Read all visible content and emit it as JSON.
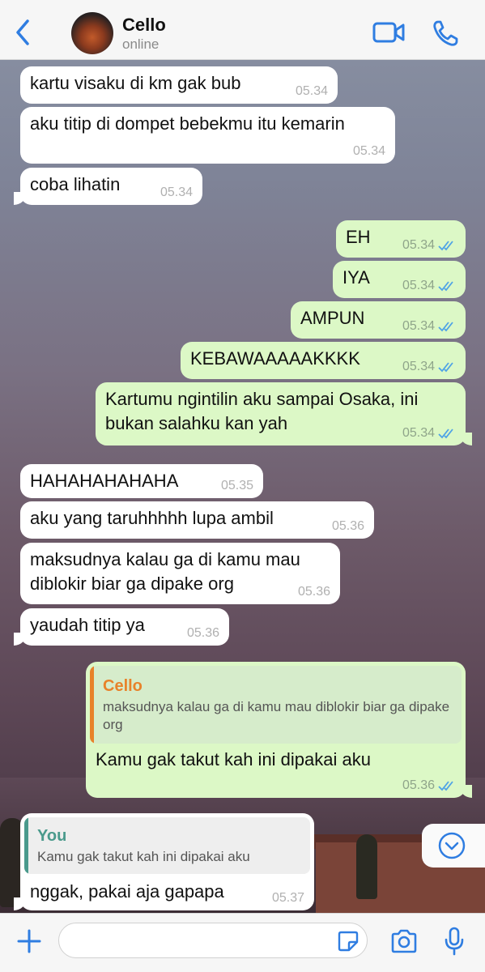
{
  "header": {
    "contact_name": "Cello",
    "status": "online"
  },
  "messages": [
    {
      "dir": "in",
      "text": "kartu visaku di km gak bub",
      "time": "05.34"
    },
    {
      "dir": "in",
      "text": "aku titip di dompet bebekmu itu kemarin",
      "time": "05.34"
    },
    {
      "dir": "in",
      "text": "coba lihatin",
      "time": "05.34"
    },
    {
      "dir": "out",
      "text": "EH",
      "time": "05.34"
    },
    {
      "dir": "out",
      "text": "IYA",
      "time": "05.34"
    },
    {
      "dir": "out",
      "text": "AMPUN",
      "time": "05.34"
    },
    {
      "dir": "out",
      "text": "KEBAWAAAAAKKKK",
      "time": "05.34"
    },
    {
      "dir": "out",
      "text": "Kartumu ngintilin aku sampai Osaka, ini bukan salahku kan yah",
      "time": "05.34"
    },
    {
      "dir": "in",
      "text": "HAHAHAHAHAHA",
      "time": "05.35"
    },
    {
      "dir": "in",
      "text": "aku yang taruhhhhh lupa ambil",
      "time": "05.36"
    },
    {
      "dir": "in",
      "text": "maksudnya kalau ga di kamu mau diblokir biar ga dipake org",
      "time": "05.36"
    },
    {
      "dir": "in",
      "text": "yaudah titip ya",
      "time": "05.36"
    },
    {
      "dir": "out",
      "text": "Kamu gak takut kah ini dipakai aku",
      "time": "05.36",
      "reply": {
        "name": "Cello",
        "text": "maksudnya kalau ga di kamu mau diblokir biar ga dipake org"
      }
    },
    {
      "dir": "in",
      "text": "nggak, pakai aja gapapa",
      "time": "05.37",
      "reply": {
        "name": "You",
        "text": "Kamu gak takut kah ini dipakai aku"
      }
    }
  ],
  "colors": {
    "accent": "#2f7de1",
    "read_ticks": "#4fa3e6",
    "reply_cello": "#e8822a",
    "reply_you": "#4a9a8c"
  },
  "icons": {
    "back": "chevron-left-icon",
    "video": "video-call-icon",
    "phone": "phone-call-icon",
    "scroll": "chevron-down-circle-icon",
    "plus": "plus-icon",
    "sticker": "sticker-icon",
    "camera": "camera-icon",
    "mic": "microphone-icon"
  }
}
